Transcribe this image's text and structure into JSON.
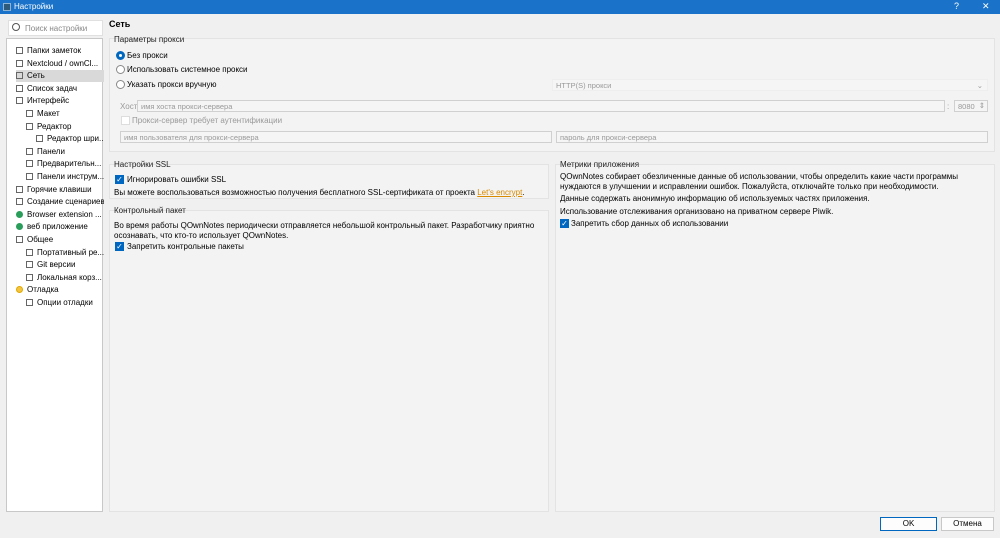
{
  "window": {
    "title": "Настройки",
    "help": "?",
    "close": "✕"
  },
  "search": {
    "placeholder": "Поиск настройки"
  },
  "tree": [
    {
      "label": "Папки заметок",
      "level": 0
    },
    {
      "label": "Nextcloud / ownCl...",
      "level": 0
    },
    {
      "label": "Сеть",
      "level": 0,
      "selected": true
    },
    {
      "label": "Список задач",
      "level": 0
    },
    {
      "label": "Интерфейс",
      "level": 0,
      "expanded": true
    },
    {
      "label": "Макет",
      "level": 1
    },
    {
      "label": "Редактор",
      "level": 1,
      "expanded": true
    },
    {
      "label": "Редактор шри...",
      "level": 2
    },
    {
      "label": "Панели",
      "level": 1
    },
    {
      "label": "Предварительн...",
      "level": 1
    },
    {
      "label": "Панели инструм...",
      "level": 1
    },
    {
      "label": "Горячие клавиши",
      "level": 0
    },
    {
      "label": "Создание сценариев",
      "level": 0
    },
    {
      "label": "Browser extension ...",
      "level": 0,
      "icon": "globe"
    },
    {
      "label": "веб приложение",
      "level": 0,
      "icon": "globe"
    },
    {
      "label": "Общее",
      "level": 0,
      "expanded": true
    },
    {
      "label": "Портативный ре...",
      "level": 1
    },
    {
      "label": "Git версии",
      "level": 1
    },
    {
      "label": "Локальная корз...",
      "level": 1
    },
    {
      "label": "Отладка",
      "level": 0,
      "expanded": true,
      "icon": "smiley"
    },
    {
      "label": "Опции отладки",
      "level": 1
    }
  ],
  "page": {
    "title": "Сеть"
  },
  "proxy": {
    "title": "Параметры прокси",
    "no_proxy": "Без прокси",
    "system_proxy": "Использовать системное прокси",
    "manual_proxy": "Указать прокси вручную",
    "type": "HTTP(S) прокси",
    "host_label": "Хост",
    "host_placeholder": "имя хоста прокси-сервера",
    "port_sep": ":",
    "port": "8080",
    "auth": "Прокси-сервер требует аутентификации",
    "user_placeholder": "имя пользователя для прокси-сервера",
    "pass_placeholder": "пароль для прокси-сервера"
  },
  "ssl": {
    "title": "Настройки SSL",
    "ignore": "Игнорировать ошибки SSL",
    "text": "Вы можете воспользоваться возможностью получения бесплатного SSL-сертификата от проекта ",
    "link": "Let's encrypt",
    "end": "."
  },
  "heartbeat": {
    "title": "Контрольный пакет",
    "text": "Во время работы QOwnNotes периодически отправляется небольшой контрольный пакет. Разработчику приятно осознавать, что кто-то использует QOwnNotes.",
    "disable": "Запретить контрольные пакеты"
  },
  "metrics": {
    "title": "Метрики приложения",
    "text1": "QOwnNotes собирает обезличенные данные об использовании, чтобы определить какие части программы нуждаются в улучшении и исправлении ошибок. Пожалуйста, отключайте только при необходимости.",
    "text2": "Данные содержать анонимную информацию об используемых частях приложения.",
    "text3": "Использование отслеживания организовано на приватном сервере Piwik.",
    "disable": "Запретить сбор данных об использовании"
  },
  "buttons": {
    "ok": "OK",
    "cancel": "Отмена"
  }
}
